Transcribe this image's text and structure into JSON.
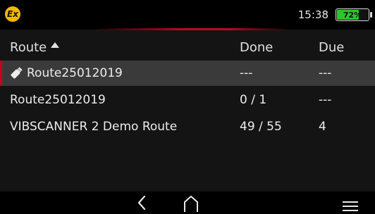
{
  "status": {
    "time": "15:38",
    "battery_text": "72%",
    "battery_level": 0.72,
    "battery_color": "#2ec52e",
    "ex_badge": "Ex"
  },
  "accent_color": "#c4001e",
  "table": {
    "columns": [
      "Route",
      "Done",
      "Due"
    ],
    "sort_column": "Route",
    "sort_direction": "ascending",
    "rows": [
      {
        "name": "Route25012019",
        "done": "---",
        "due": "---",
        "icon": "usb-stick-icon",
        "selected": true
      },
      {
        "name": "Route25012019",
        "done": "0 / 1",
        "due": "---",
        "icon": "",
        "selected": false
      },
      {
        "name": "VIBSCANNER 2 Demo Route",
        "done": "49 / 55",
        "due": "4",
        "icon": "",
        "selected": false
      }
    ]
  },
  "navbar": {
    "icons": [
      "back-icon",
      "home-icon",
      "menu-icon"
    ]
  }
}
